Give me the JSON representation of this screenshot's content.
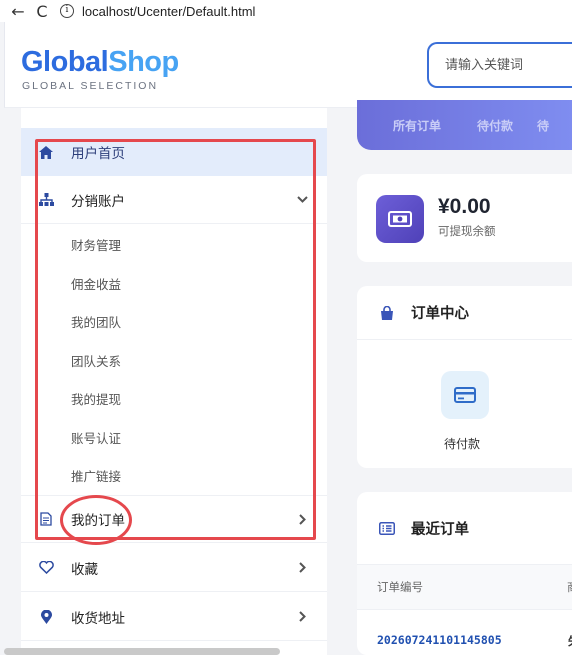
{
  "browser": {
    "url": "localhost/Ucenter/Default.html",
    "back_glyph": "←",
    "reload_glyph": "C",
    "info_glyph": "i"
  },
  "header": {
    "logo_part1": "Global",
    "logo_part2": "Shop",
    "logo_tagline": "GLOBAL SELECTION",
    "search_placeholder": "请输入关键词"
  },
  "sidebar": {
    "home": "用户首页",
    "distribution": "分销账户",
    "sub_items": [
      "财务管理",
      "佣金收益",
      "我的团队",
      "团队关系",
      "我的提现",
      "账号认证",
      "推广链接"
    ],
    "orders": "我的订单",
    "favorites": "收藏",
    "address": "收货地址"
  },
  "order_tabs": [
    "所有订单",
    "待付款",
    "待"
  ],
  "balance": {
    "amount": "¥0.00",
    "label": "可提现余额"
  },
  "order_center": {
    "title": "订单中心",
    "pending_payment": "待付款"
  },
  "recent_orders": {
    "title": "最近订单",
    "col_order_no": "订单编号",
    "col_partial": "商",
    "rows": [
      {
        "order_no": "202607241101145805",
        "partial": "失"
      }
    ]
  },
  "colors": {
    "brand_blue": "#2d6cdf",
    "brand_light": "#47a3f3",
    "highlight_red": "#e5484d",
    "accent_purple": "#6b6ed9"
  }
}
